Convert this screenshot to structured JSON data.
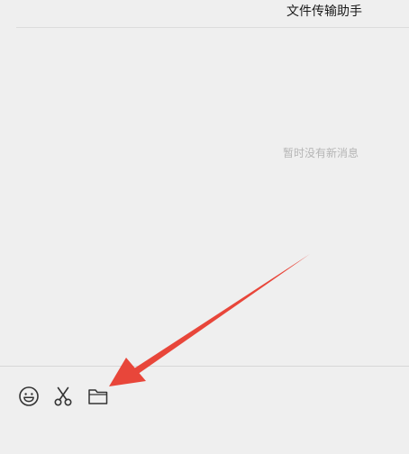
{
  "header": {
    "title": "文件传输助手"
  },
  "messages": {
    "empty_text": "暂时没有新消息"
  },
  "toolbar": {
    "icons": [
      "emoji-icon",
      "scissors-icon",
      "folder-icon"
    ]
  },
  "annotation": {
    "arrow_color": "#e8463a"
  },
  "colors": {
    "background": "#efefef",
    "divider": "#dcdcdc",
    "hint_text": "#b5b5b5"
  }
}
